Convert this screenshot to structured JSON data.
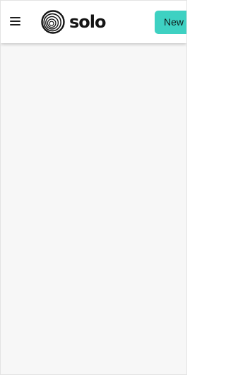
{
  "header": {
    "menu_icon": "hamburger-menu-icon",
    "logo_icon": "solo-spiral-logo",
    "brand_name": "solo",
    "new_button_label": "New C"
  },
  "colors": {
    "accent": "#3ed1c2",
    "header_bg": "#ffffff",
    "content_bg": "#f7f7f7",
    "text_dark": "#141414"
  }
}
